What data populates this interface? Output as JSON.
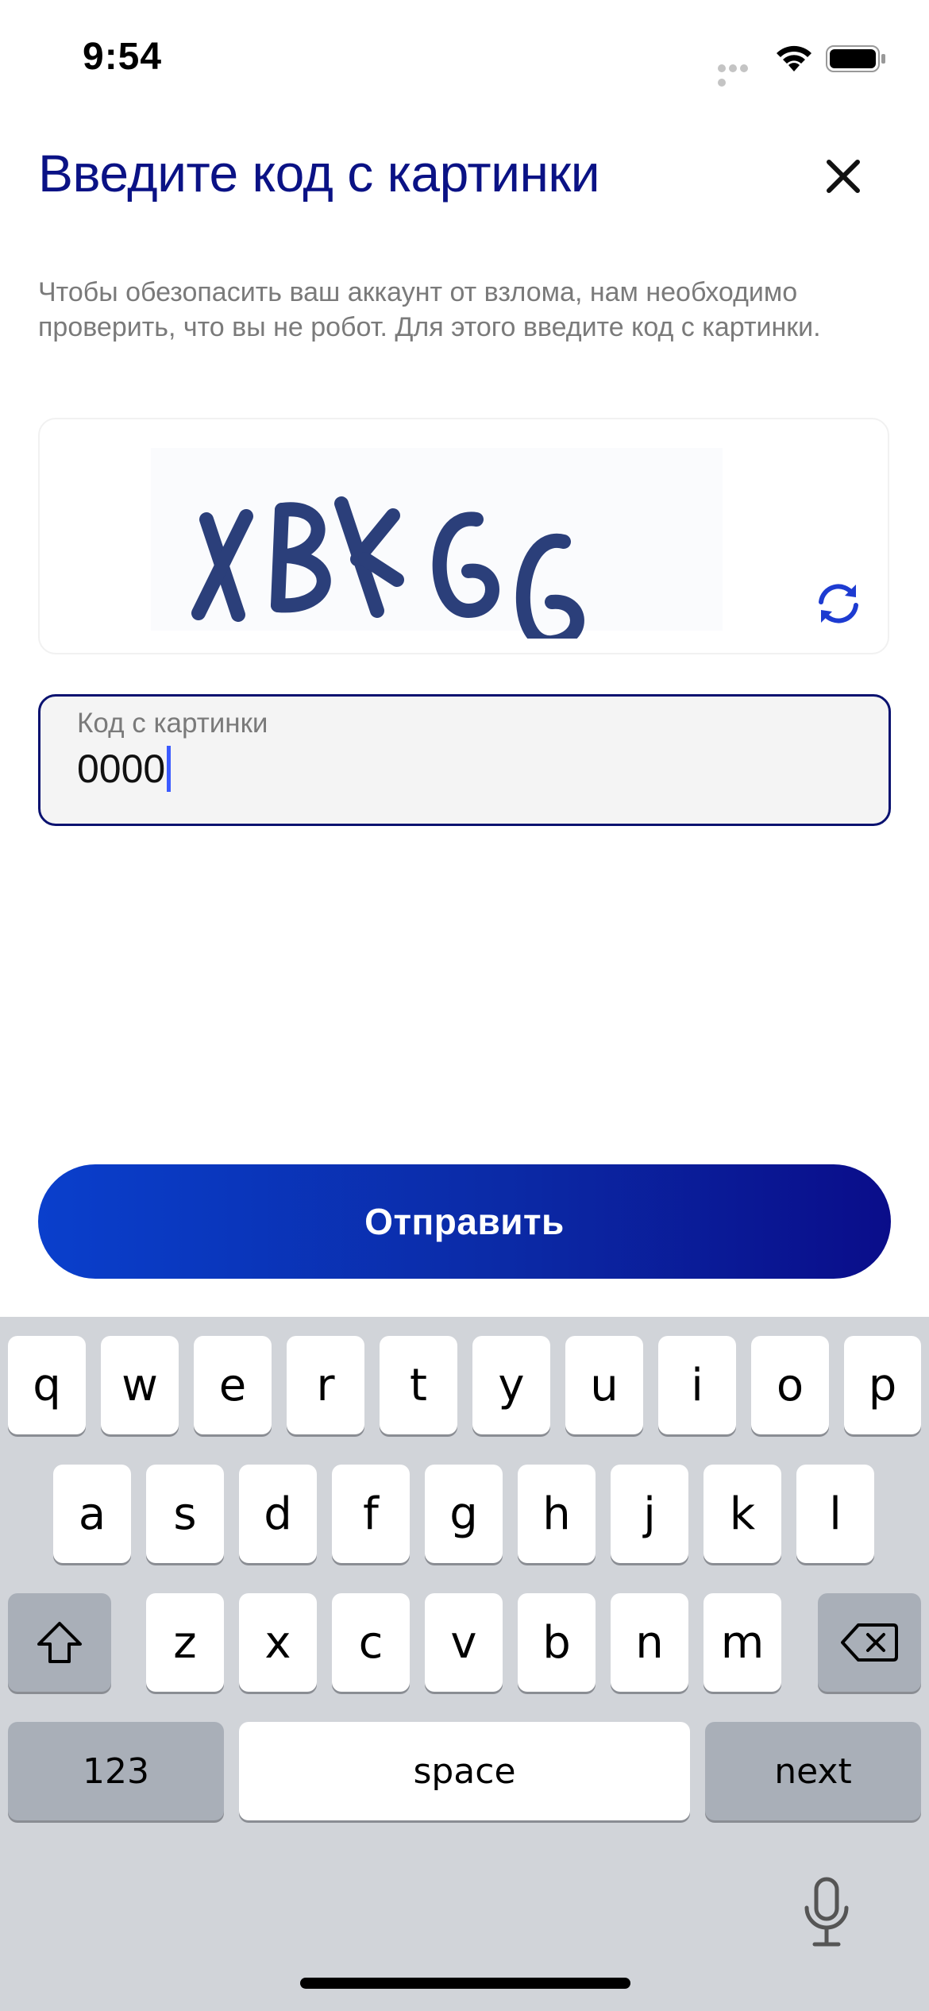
{
  "status_bar": {
    "time": "9:54"
  },
  "header": {
    "title": "Введите код с картинки"
  },
  "description": "Чтобы обезопасить ваш аккаунт от взлома, нам необходимо проверить, что вы не робот. Для этого введите код с картинки.",
  "captcha": {
    "text": "XBXGG"
  },
  "code_field": {
    "label": "Код с картинки",
    "value": "0000"
  },
  "submit_label": "Отправить",
  "keyboard": {
    "row1": [
      "q",
      "w",
      "e",
      "r",
      "t",
      "y",
      "u",
      "i",
      "o",
      "p"
    ],
    "row2": [
      "a",
      "s",
      "d",
      "f",
      "g",
      "h",
      "j",
      "k",
      "l"
    ],
    "row3": [
      "z",
      "x",
      "c",
      "v",
      "b",
      "n",
      "m"
    ],
    "numbers_label": "123",
    "space_label": "space",
    "next_label": "next"
  },
  "colors": {
    "title": "#0a1285",
    "accent": "#0b2aa6",
    "keyboard_bg": "#d1d4d9"
  }
}
